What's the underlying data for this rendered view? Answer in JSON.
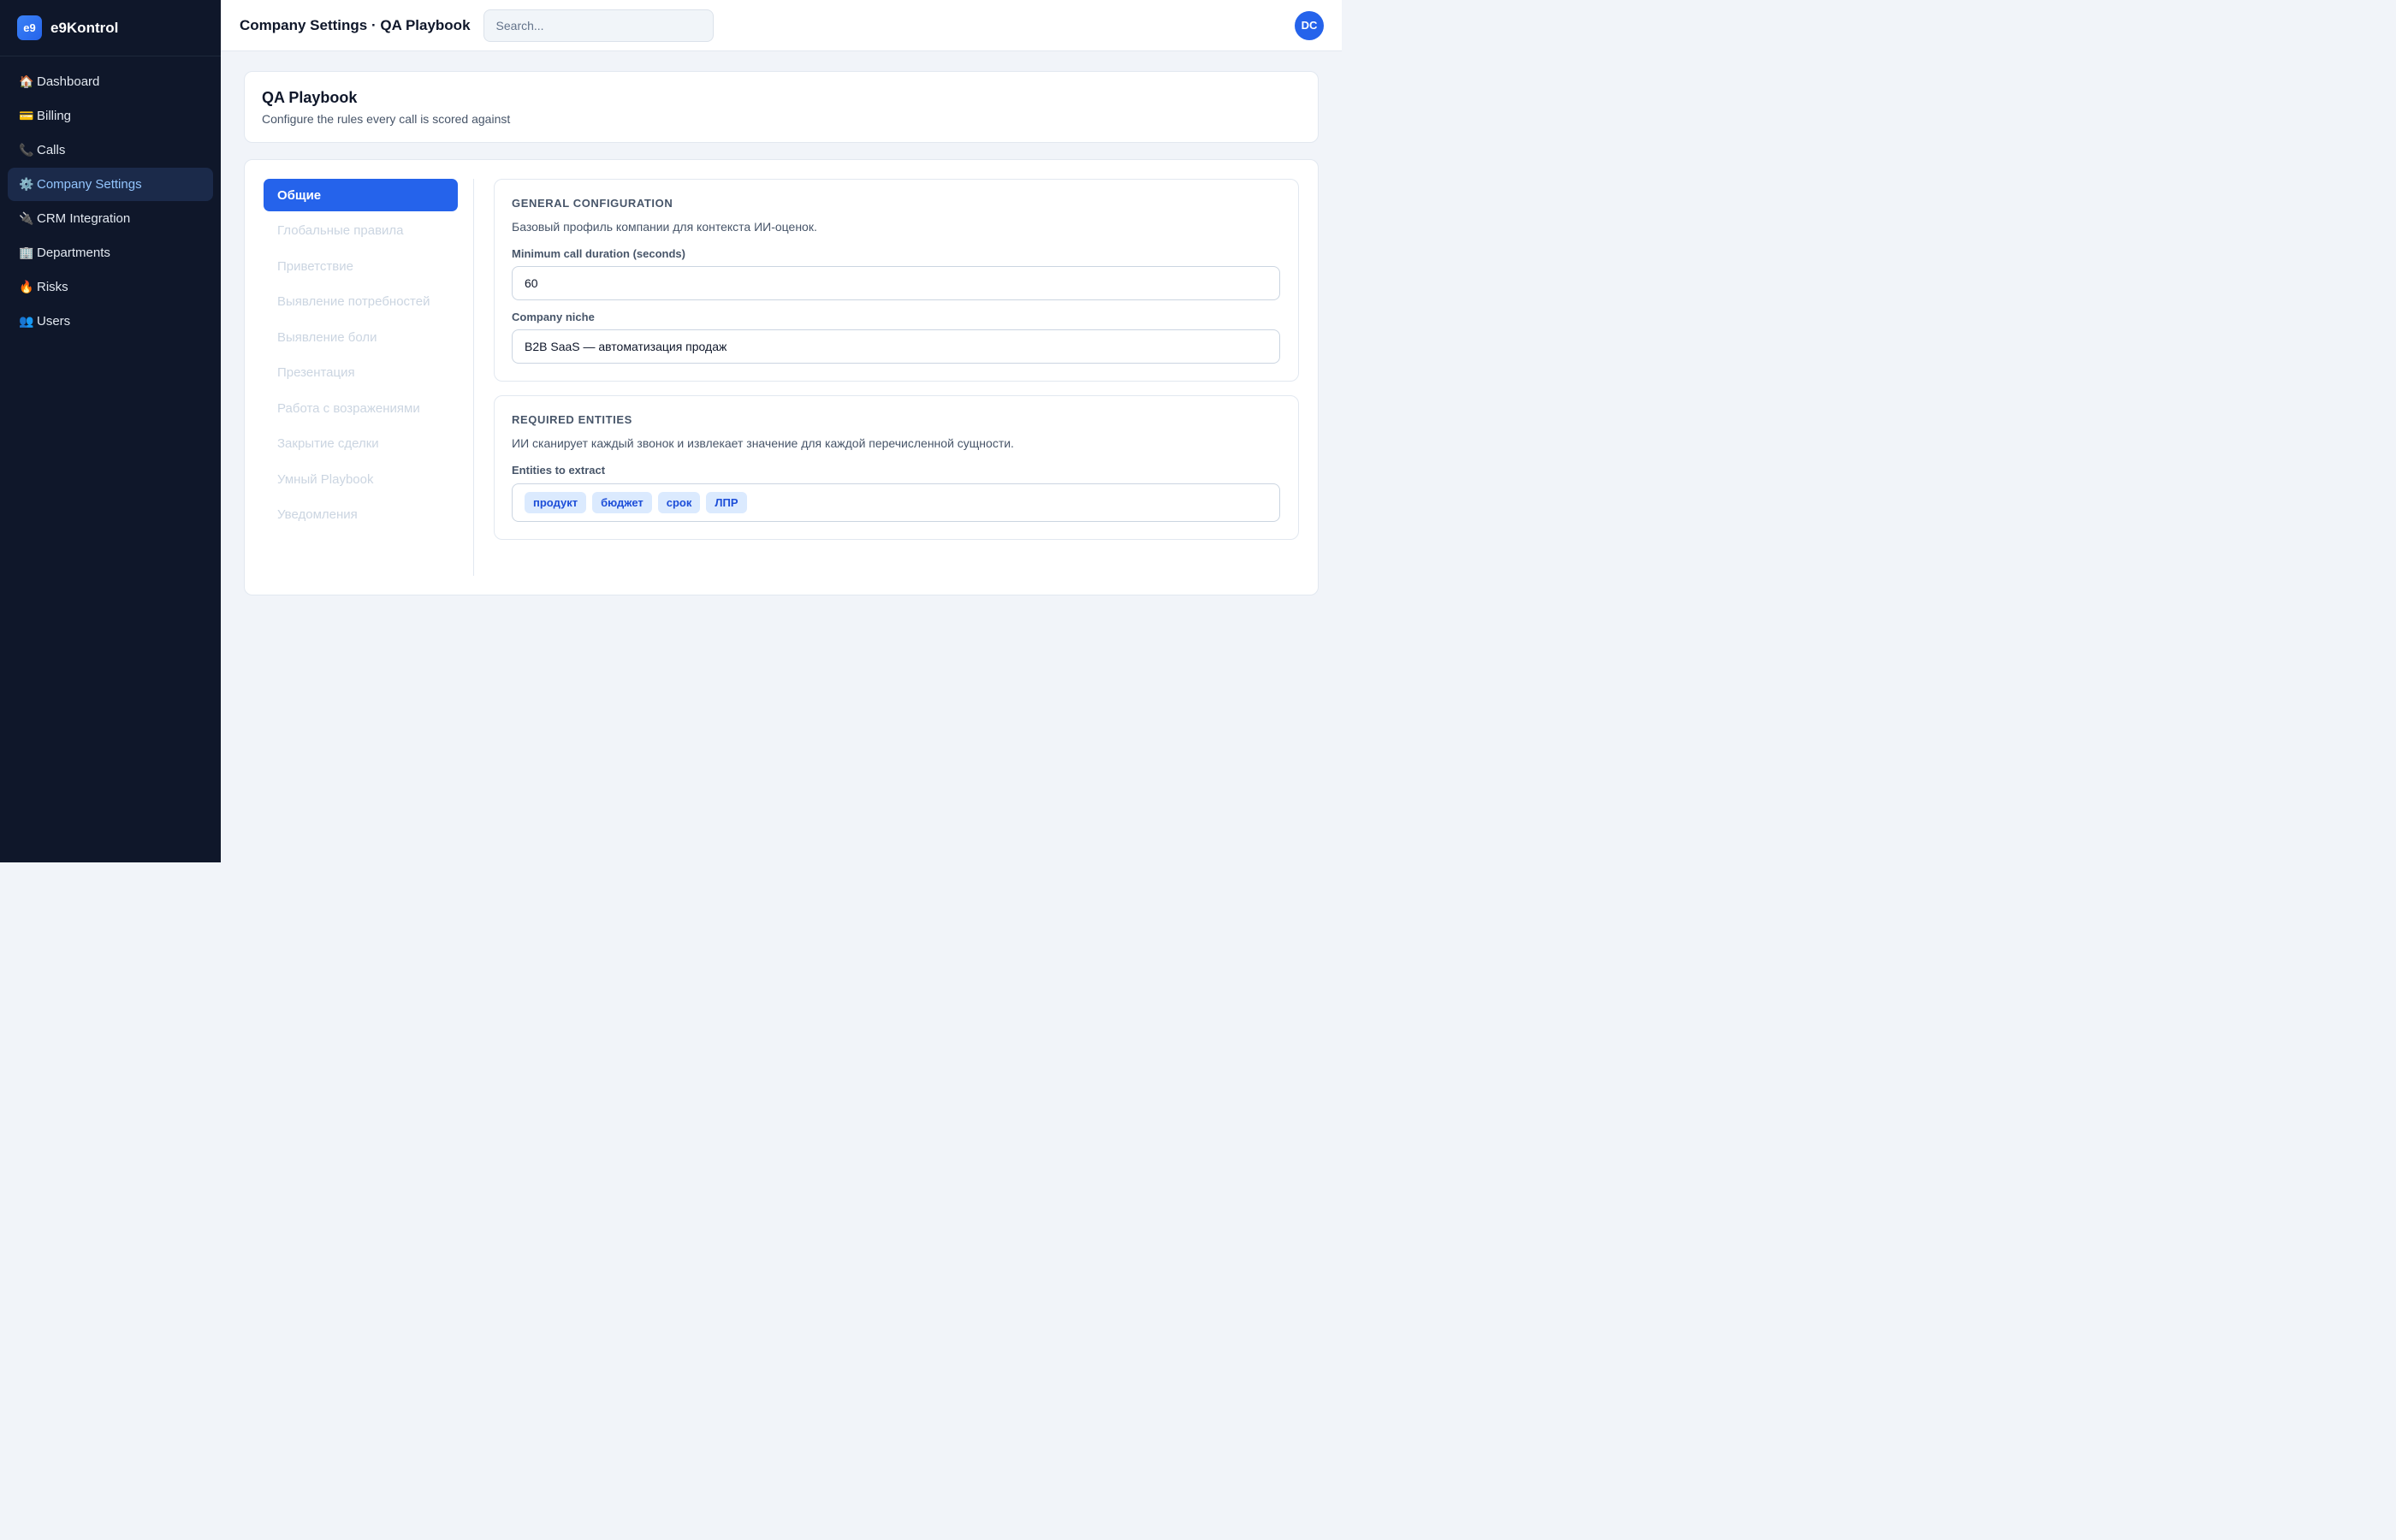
{
  "brand": {
    "logo": "e9",
    "name": "e9Kontrol"
  },
  "sidebar": {
    "items": [
      {
        "icon": "🏠",
        "label": "Dashboard"
      },
      {
        "icon": "💳",
        "label": "Billing"
      },
      {
        "icon": "📞",
        "label": "Calls"
      },
      {
        "icon": "⚙️",
        "label": "Company Settings"
      },
      {
        "icon": "🔌",
        "label": "CRM Integration"
      },
      {
        "icon": "🏢",
        "label": "Departments"
      },
      {
        "icon": "🔥",
        "label": "Risks"
      },
      {
        "icon": "👥",
        "label": "Users"
      }
    ],
    "active_index": 3
  },
  "header": {
    "title": "Company Settings · QA Playbook",
    "search_placeholder": "Search...",
    "avatar": "DC"
  },
  "page": {
    "title": "QA Playbook",
    "subtitle": "Configure the rules every call is scored against"
  },
  "tabs": [
    "Общие",
    "Глобальные правила",
    "Приветствие",
    "Выявление потребностей",
    "Выявление боли",
    "Презентация",
    "Работа с возражениями",
    "Закрытие сделки",
    "Умный Playbook",
    "Уведомления"
  ],
  "general": {
    "title": "GENERAL CONFIGURATION",
    "description": "Базовый профиль компании для контекста ИИ-оценок.",
    "min_duration_label": "Minimum call duration (seconds)",
    "min_duration_value": "60",
    "niche_label": "Company niche",
    "niche_value": "B2B SaaS — автоматизация продаж"
  },
  "entities": {
    "title": "REQUIRED ENTITIES",
    "description": "ИИ сканирует каждый звонок и извлекает значение для каждой перечисленной сущности.",
    "label": "Entities to extract",
    "tags": [
      "продукт",
      "бюджет",
      "срок",
      "ЛПР"
    ]
  },
  "colors": {
    "sidebar_bg": "#0f172a",
    "accent": "#2563eb",
    "active_nav_text": "#93c5fd",
    "tag_bg": "#dbeafe",
    "tag_text": "#1d4ed8"
  }
}
